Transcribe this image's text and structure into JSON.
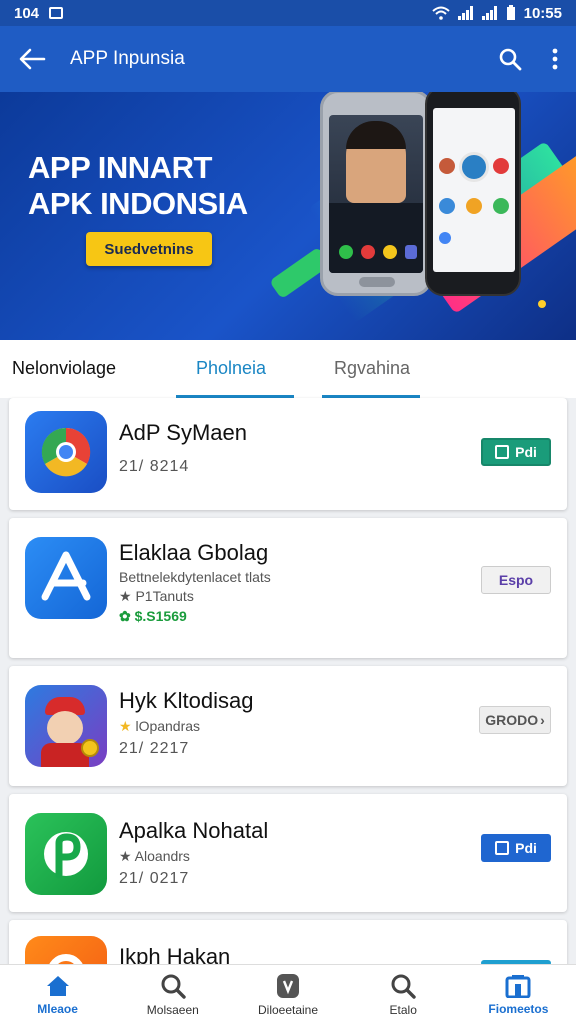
{
  "status_bar": {
    "left_time": "104",
    "right_time": "10:55"
  },
  "app_bar": {
    "title": "APP Inpunsia"
  },
  "hero": {
    "line1": "APP INNART",
    "line2": "APK INDONSIA",
    "cta": "Suedvetnins"
  },
  "tabs": [
    {
      "label": "Nelonviolage"
    },
    {
      "label": "Pholneia"
    },
    {
      "label": "Rgvahina"
    }
  ],
  "apps": [
    {
      "name": "AdP SyMaen",
      "line1": "21/ 8214",
      "line2": "",
      "line3": "",
      "action": "Pdi"
    },
    {
      "name": "Elaklaa Gbolag",
      "line1": "Bettnelekdytenlacet tlats",
      "line2": "P1Tanuts",
      "line3": "$.S1569",
      "action": "Espo"
    },
    {
      "name": "Hyk Kltodisag",
      "line1": "lOpandras",
      "line2": "21/ 2217",
      "line3": "",
      "action": "GRODO"
    },
    {
      "name": "Apalka Nohatal",
      "line1": "Aloandrs",
      "line2": "21/ 0217",
      "line3": "",
      "action": "Pdi"
    },
    {
      "name": "Ikph Hakan",
      "line1": "",
      "line2": "",
      "line3": "",
      "action": ""
    }
  ],
  "bottom_nav": [
    {
      "label": "Mleaoe",
      "icon": "home-icon"
    },
    {
      "label": "Molsaeen",
      "icon": "search-icon"
    },
    {
      "label": "Diloeetaine",
      "icon": "shield-icon"
    },
    {
      "label": "Etalo",
      "icon": "search-icon"
    },
    {
      "label": "Fiomeetos",
      "icon": "store-icon"
    }
  ],
  "colors": {
    "accent": "#1f5cc4",
    "tab_active": "#1a86c4",
    "cta": "#f7c614",
    "price_green": "#1a9c3c"
  }
}
